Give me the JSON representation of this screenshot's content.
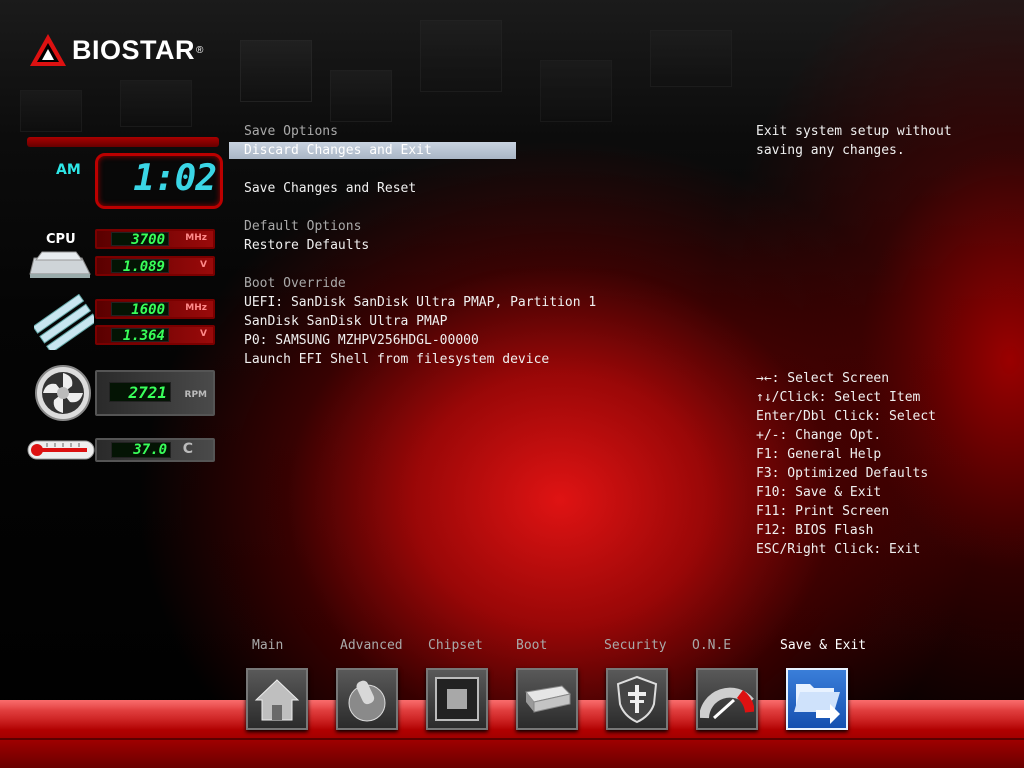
{
  "brand": {
    "name": "BIOSTAR",
    "trademark": "®"
  },
  "monitor": {
    "clock": {
      "ampm": "AM",
      "time": "1:02"
    },
    "cpu_label": "CPU",
    "cpu_freq": {
      "value": "3700",
      "unit": "MHz"
    },
    "cpu_voltage": {
      "value": "1.089",
      "unit": "V"
    },
    "mem_freq": {
      "value": "1600",
      "unit": "MHz"
    },
    "mem_voltage": {
      "value": "1.364",
      "unit": "V"
    },
    "fan": {
      "value": "2721",
      "unit": "RPM"
    },
    "temp": {
      "value": "37.0",
      "unit": "C"
    },
    "icons": [
      "cpu-chip-icon",
      "memory-modules-icon",
      "fan-icon",
      "thermometer-icon"
    ]
  },
  "menu": {
    "save_options_header": "Save Options",
    "discard_changes_and_exit": "Discard Changes and Exit",
    "save_changes_and_reset": "Save Changes and Reset",
    "default_options_header": "Default Options",
    "restore_defaults": "Restore Defaults",
    "boot_override_header": "Boot Override",
    "boot_items": [
      "UEFI: SanDisk SanDisk Ultra PMAP, Partition 1",
      "SanDisk SanDisk Ultra PMAP",
      "P0: SAMSUNG MZHPV256HDGL-00000",
      "Launch EFI Shell from filesystem device"
    ]
  },
  "help": {
    "description": [
      "Exit system setup without",
      "saving any changes."
    ],
    "keys": [
      "→←: Select Screen",
      "↑↓/Click: Select Item",
      "Enter/Dbl Click: Select",
      "+/-: Change Opt.",
      "F1: General Help",
      "F3: Optimized Defaults",
      "F10: Save & Exit",
      "F11: Print Screen",
      "F12: BIOS Flash",
      "ESC/Right Click: Exit"
    ]
  },
  "tabs": {
    "main": "Main",
    "advanced": "Advanced",
    "chipset": "Chipset",
    "boot": "Boot",
    "security": "Security",
    "one": "O.N.E",
    "save_exit": "Save & Exit",
    "active": "Save & Exit"
  },
  "colors": {
    "accent_red": "#d01818",
    "lcd_green": "#39ff5a",
    "clock_cyan": "#3ad6e6",
    "highlight": "#b8c4d4",
    "active_tab": "#1f63c4"
  }
}
